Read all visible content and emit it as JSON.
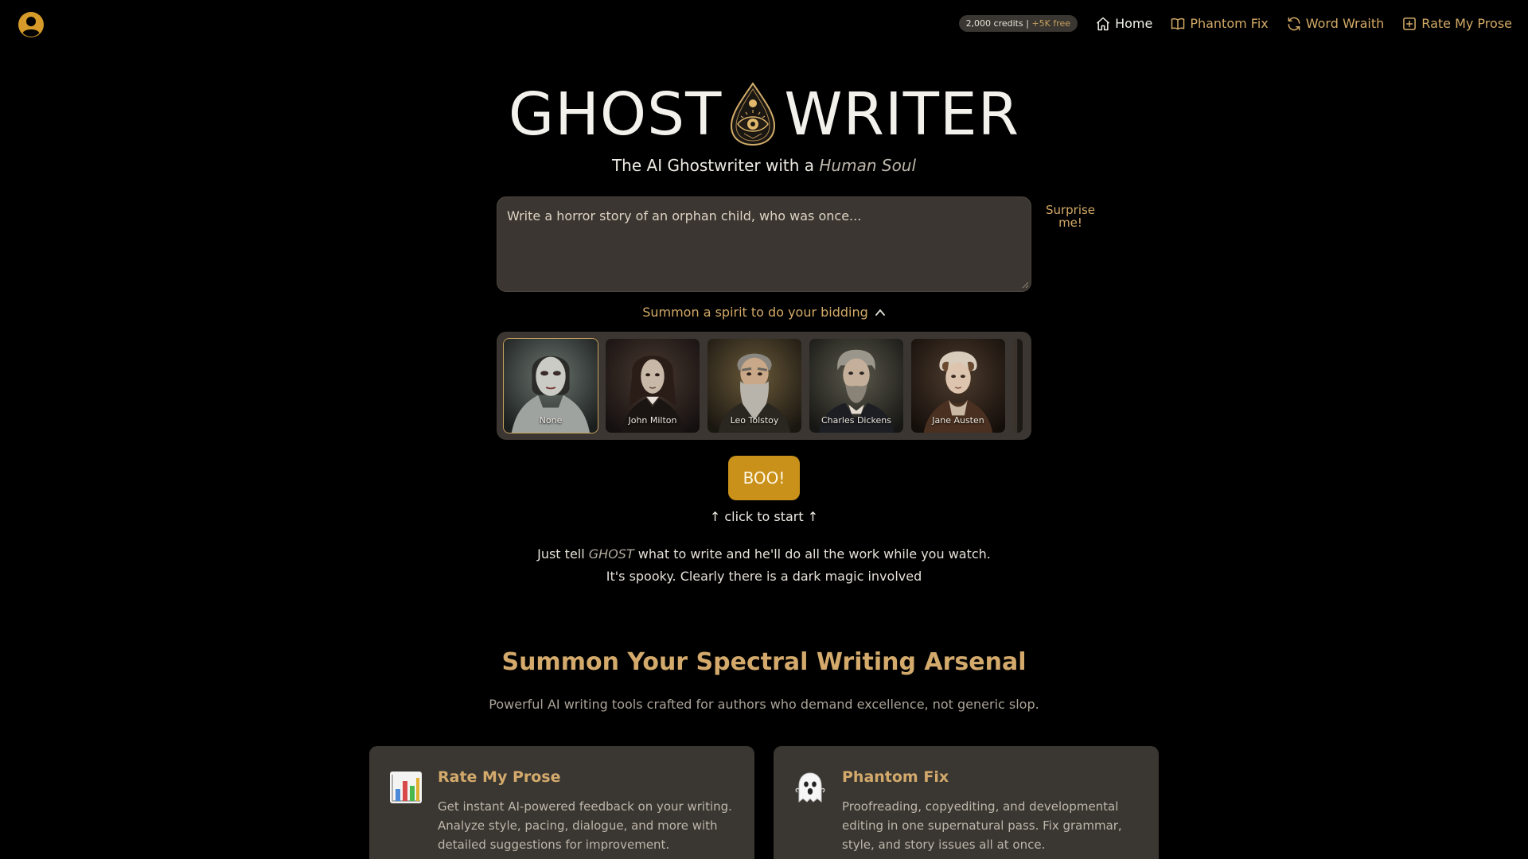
{
  "header": {
    "credits_amount": "2,000 credits |",
    "credits_free": "+5K free",
    "nav": [
      {
        "label": "Home",
        "icon": "home-icon"
      },
      {
        "label": "Phantom Fix",
        "icon": "book-icon"
      },
      {
        "label": "Word Wraith",
        "icon": "refresh-icon"
      },
      {
        "label": "Rate My Prose",
        "icon": "plus-square-icon"
      }
    ]
  },
  "hero": {
    "logo_left": "GHOST",
    "logo_right": "WRITER",
    "tagline_prefix": "The AI Ghostwriter with a ",
    "tagline_emphasis": "Human Soul"
  },
  "prompt": {
    "placeholder": "Write a horror story of an orphan child, who was once..."
  },
  "surprise_label": "Surprise me!",
  "summon_label": "Summon a spirit to do your bidding",
  "spirits": [
    {
      "name": "None",
      "selected": true
    },
    {
      "name": "John Milton",
      "selected": false
    },
    {
      "name": "Leo Tolstoy",
      "selected": false
    },
    {
      "name": "Charles Dickens",
      "selected": false
    },
    {
      "name": "Jane Austen",
      "selected": false
    }
  ],
  "boo_label": "BOO!",
  "click_hint": "↑ click to start ↑",
  "description": {
    "line1_prefix": "Just tell ",
    "line1_ghost": "GHOST",
    "line1_suffix": " what to write and he'll do all the work while you watch.",
    "line2": "It's spooky. Clearly there is a dark magic involved"
  },
  "arsenal": {
    "title": "Summon Your Spectral Writing Arsenal",
    "subtitle": "Powerful AI writing tools crafted for authors who demand excellence, not generic slop.",
    "cards": [
      {
        "icon": "bar-chart-icon",
        "title": "Rate My Prose",
        "text": "Get instant AI-powered feedback on your writing. Analyze style, pacing, dialogue, and more with detailed suggestions for improvement."
      },
      {
        "icon": "ghost-icon",
        "title": "Phantom Fix",
        "text": "Proofreading, copyediting, and developmental editing in one supernatural pass. Fix grammar, style, and story issues all at once."
      }
    ]
  },
  "colors": {
    "accent": "#d3aa67",
    "button": "#c9901a",
    "panel": "#3b3631",
    "background": "#000000"
  }
}
